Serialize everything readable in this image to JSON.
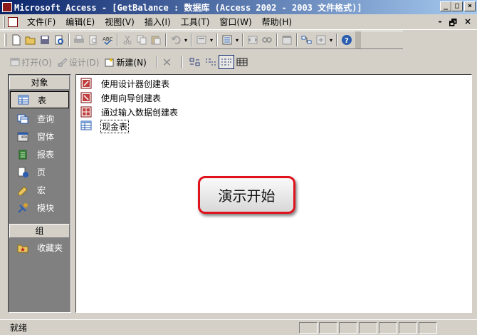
{
  "window": {
    "title": "Microsoft Access - [GetBalance : 数据库 (Access 2002 - 2003 文件格式)]",
    "controls": [
      "_",
      "□",
      "×"
    ]
  },
  "menubar": {
    "items": [
      "文件(F)",
      "编辑(E)",
      "视图(V)",
      "插入(I)",
      "工具(T)",
      "窗口(W)",
      "帮助(H)"
    ],
    "mdi_controls": [
      "-",
      "🗗",
      "×"
    ]
  },
  "toolbar": {
    "icons": [
      "new-icon",
      "open-icon",
      "save-icon",
      "file-search-icon",
      "print-icon",
      "print-preview-icon",
      "spelling-icon",
      "cut-icon",
      "copy-icon",
      "paste-icon",
      "undo-icon",
      "office-links-icon",
      "analyze-icon",
      "code-icon",
      "relationships-icon",
      "properties-icon",
      "new-object-icon",
      "help-icon"
    ]
  },
  "db_toolbar": {
    "open_label": "打开(O)",
    "design_label": "设计(D)",
    "new_label": "新建(N)"
  },
  "objects_bar": {
    "header": "对象",
    "items": [
      {
        "label": "表",
        "icon": "table-icon"
      },
      {
        "label": "查询",
        "icon": "query-icon"
      },
      {
        "label": "窗体",
        "icon": "form-icon"
      },
      {
        "label": "报表",
        "icon": "report-icon"
      },
      {
        "label": "页",
        "icon": "page-icon"
      },
      {
        "label": "宏",
        "icon": "macro-icon"
      },
      {
        "label": "模块",
        "icon": "module-icon"
      }
    ],
    "group_header": "组",
    "group_items": [
      {
        "label": "收藏夹",
        "icon": "favorites-icon"
      }
    ]
  },
  "object_list": {
    "items": [
      {
        "label": "使用设计器创建表",
        "icon": "design-wizard-icon"
      },
      {
        "label": "使用向导创建表",
        "icon": "wizard-icon"
      },
      {
        "label": "通过输入数据创建表",
        "icon": "datasheet-wizard-icon"
      },
      {
        "label": "现金表",
        "icon": "table-icon"
      }
    ]
  },
  "demo_button": {
    "label": "演示开始"
  },
  "statusbar": {
    "text": "就绪"
  }
}
